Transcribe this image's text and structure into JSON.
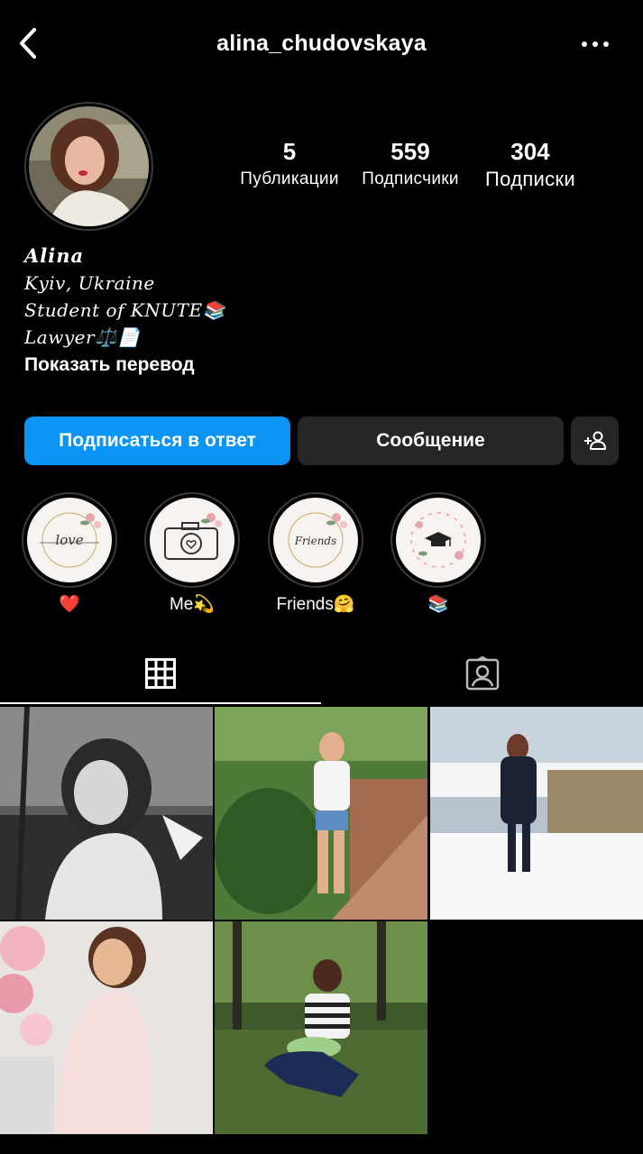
{
  "header": {
    "username": "alina_chudovskaya",
    "back_icon": "chevron-left-icon",
    "more_icon": "more-horizontal-icon"
  },
  "stats": {
    "posts": {
      "value": "5",
      "label": "Публикации"
    },
    "followers": {
      "value": "559",
      "label": "Подписчики"
    },
    "following": {
      "value": "304",
      "label": "Подписки"
    }
  },
  "bio": {
    "name": "𝑨𝒍𝒊𝒏𝒂",
    "lines": [
      "𝐾𝑦𝑖𝑣, 𝑈𝑘𝑟𝑎𝑖𝑛𝑒",
      "𝑆𝑡𝑢𝑑𝑒𝑛𝑡 𝑜𝑓 𝐾𝑁𝑈𝑇𝐸📚",
      "𝐿𝑎𝑤𝑦𝑒𝑟⚖️📄"
    ],
    "translate_label": "Показать перевод"
  },
  "actions": {
    "follow_back_label": "Подписаться в ответ",
    "message_label": "Сообщение",
    "add_person_icon": "add-person-icon"
  },
  "highlights": [
    {
      "label": "❤️",
      "cover_text": "love"
    },
    {
      "label": "Me💫",
      "cover_text": ""
    },
    {
      "label": "Friends🤗",
      "cover_text": "Friends"
    },
    {
      "label": "📚",
      "cover_text": ""
    }
  ],
  "tabs": {
    "grid_icon": "grid-icon",
    "tagged_icon": "tagged-person-icon",
    "active": "grid"
  },
  "colors": {
    "background": "#000000",
    "follow_button": "#0a95f6",
    "secondary_button": "#262626"
  }
}
